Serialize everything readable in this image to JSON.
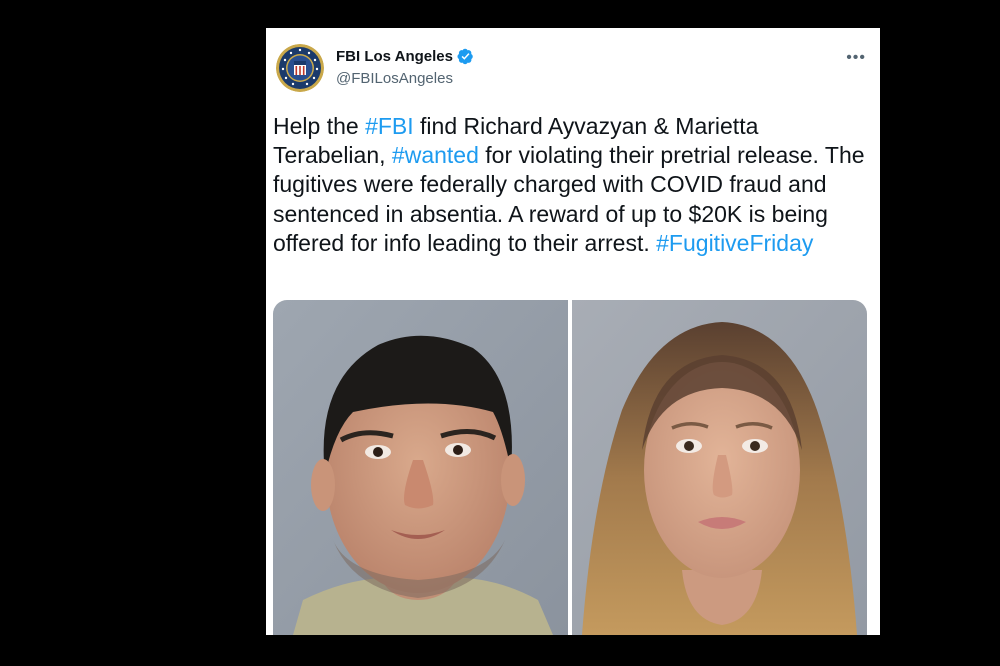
{
  "tweet": {
    "author_name": "FBI Los Angeles",
    "author_handle": "@FBILosAngeles",
    "more_label": "•••",
    "text": {
      "p1": "Help the ",
      "h1": "#FBI",
      "p2": " find Richard Ayvazyan & Marietta Terabelian, ",
      "h2": "#wanted",
      "p3": " for violating their pretrial release. The fugitives were federally charged with COVID fraud and sentenced in absentia. A reward of up to $20K is being offered for info leading to their arrest. ",
      "h3": "#FugitiveFriday"
    }
  },
  "icons": {
    "avatar": "fbi-seal-icon",
    "verified": "verified-badge-icon",
    "more": "more-options-icon"
  },
  "colors": {
    "hashtag": "#1d9bf0",
    "text": "#0f1419",
    "secondary": "#536471",
    "verified": "#1d9bf0",
    "background": "#000000",
    "card": "#ffffff"
  }
}
